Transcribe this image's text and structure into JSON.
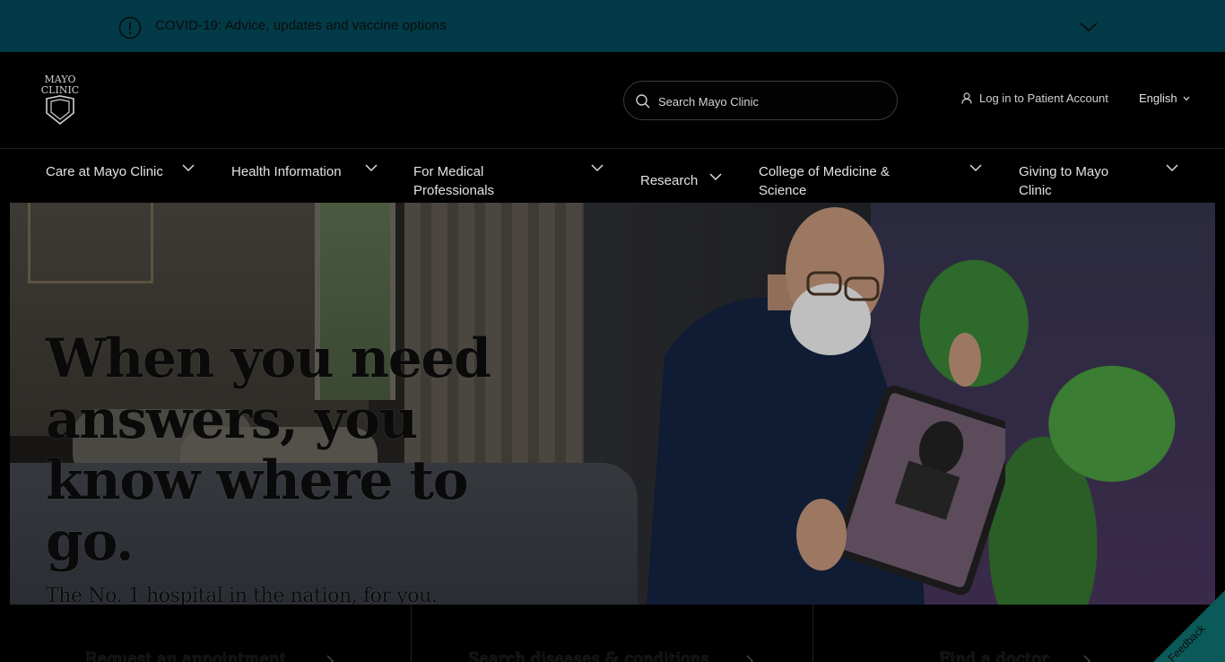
{
  "alert": {
    "text": "COVID-19: Advice, updates and vaccine options"
  },
  "header": {
    "logo_text": [
      "MAYO",
      "CLINIC"
    ],
    "search_placeholder": "Search Mayo Clinic",
    "login_label": "Log in to Patient Account",
    "language_label": "English"
  },
  "nav": {
    "items": [
      {
        "label": "Care at Mayo Clinic"
      },
      {
        "label": "Health Information"
      },
      {
        "label": "For Medical Professionals"
      },
      {
        "label": "Research"
      },
      {
        "label": "College of Medicine & Science"
      },
      {
        "label": "Giving to Mayo Clinic"
      }
    ]
  },
  "hero": {
    "title": "When you need answers, you know where to go.",
    "subtitle": "The No. 1 hospital in the nation, for you."
  },
  "cards": [
    {
      "label": "Request an appointment"
    },
    {
      "label": "Search diseases & conditions"
    },
    {
      "label": "Find a doctor"
    }
  ],
  "feedback": {
    "label": "Feedback"
  },
  "colors": {
    "alert_bg": "#023a47",
    "page_bg": "#000000",
    "feedback_bg": "#0b5a5a"
  }
}
